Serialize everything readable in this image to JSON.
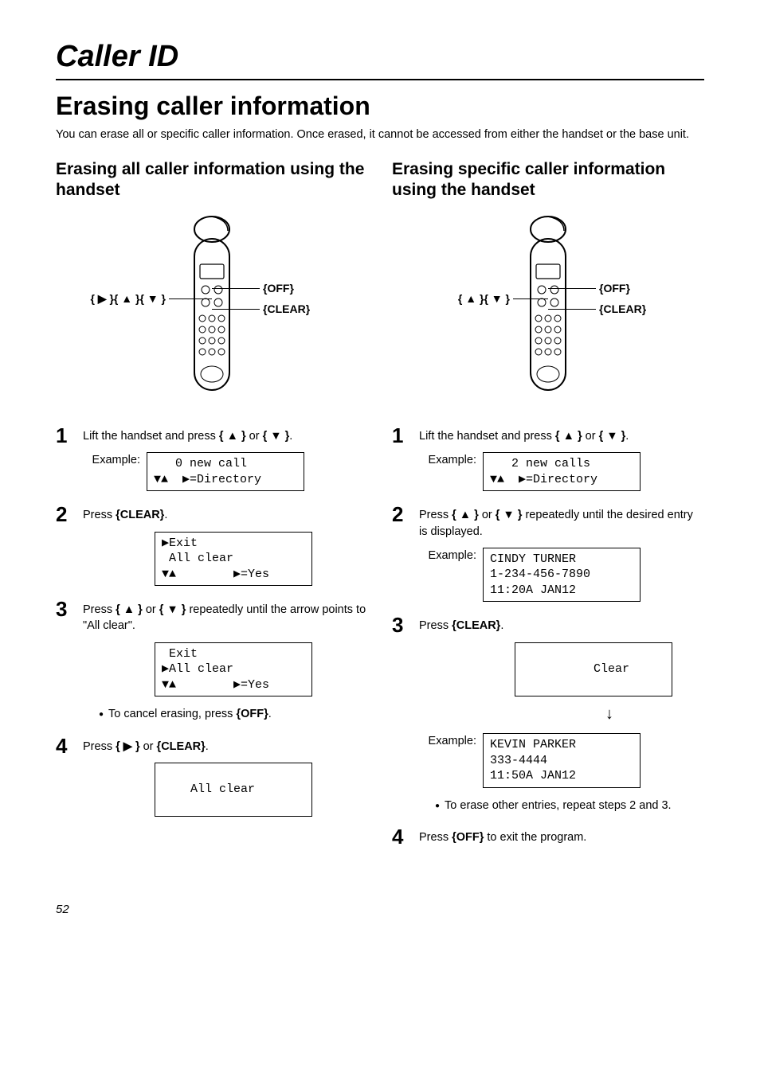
{
  "page_title": "Caller ID",
  "main_heading": "Erasing caller information",
  "intro": "You can erase all or specific caller information. Once erased, it cannot be accessed from either the handset or the base unit.",
  "left": {
    "heading": "Erasing all caller information using the handset",
    "callouts": {
      "off": "OFF",
      "clear": "CLEAR",
      "nav": "{ ▶ }{ ▲ }{ ▼ }"
    },
    "step1_text_a": "Lift the handset and press ",
    "step1_key1": "{ ▲ }",
    "step1_or": " or ",
    "step1_key2": "{ ▼ }",
    "step1_end": ".",
    "example_label": "Example:",
    "lcd1": "   0 new call\n▼▲  ▶=Directory",
    "step2_text": "Press ",
    "step2_key": "{CLEAR}",
    "step2_end": ".",
    "lcd2": "▶Exit\n All clear\n▼▲        ▶=Yes",
    "step3_text_a": "Press ",
    "step3_key1": "{ ▲ }",
    "step3_or": " or ",
    "step3_key2": "{ ▼ }",
    "step3_text_b": " repeatedly until the arrow points to \"All clear\".",
    "lcd3": " Exit\n▶All clear\n▼▲        ▶=Yes",
    "bullet1_a": "To cancel erasing, press ",
    "bullet1_key": "{OFF}",
    "bullet1_b": ".",
    "step4_text_a": "Press ",
    "step4_key1": "{ ▶ }",
    "step4_or": " or ",
    "step4_key2": "{CLEAR}",
    "step4_end": ".",
    "lcd4": "\n    All clear\n "
  },
  "right": {
    "heading": "Erasing specific caller information using the handset",
    "callouts": {
      "off": "OFF",
      "clear": "CLEAR",
      "nav": "{ ▲ }{ ▼ }"
    },
    "step1_text_a": "Lift the handset and press ",
    "step1_key1": "{ ▲ }",
    "step1_or": " or ",
    "step1_key2": "{ ▼ }",
    "step1_end": ".",
    "example_label": "Example:",
    "lcd1": "   2 new calls\n▼▲  ▶=Directory",
    "step2_text_a": "Press ",
    "step2_key1": "{ ▲ }",
    "step2_or": " or ",
    "step2_key2": "{ ▼ }",
    "step2_text_b": " repeatedly until the desired entry is displayed.",
    "lcd2": "CINDY TURNER\n1-234-456-7890\n11:20A JAN12",
    "step3_text": "Press ",
    "step3_key": "{CLEAR}",
    "step3_end": ".",
    "lcd3a": "\n     Clear\n ",
    "lcd3b": "KEVIN PARKER\n333-4444\n11:50A JAN12",
    "bullet1": "To erase other entries, repeat steps 2 and 3.",
    "step4_text_a": "Press ",
    "step4_key": "{OFF}",
    "step4_text_b": " to exit the program."
  },
  "page_number": "52"
}
